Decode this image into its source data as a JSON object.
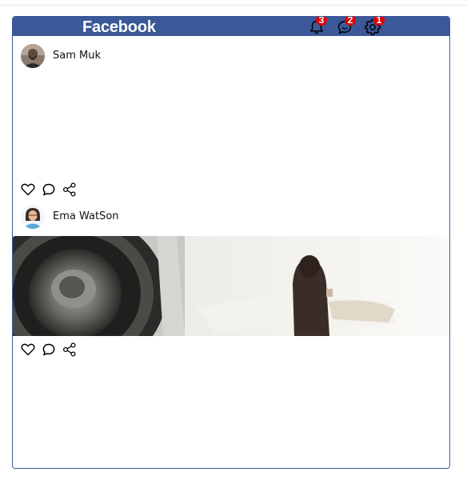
{
  "navbar": {
    "brand": "Facebook",
    "notifications": {
      "icon": "bell-icon",
      "count": "3"
    },
    "messages": {
      "icon": "chat-bubbles-icon",
      "count": "2"
    },
    "settings": {
      "icon": "gear-icon",
      "count": "1"
    }
  },
  "posts": [
    {
      "author": "Sam Muk",
      "avatar": "avatar-photo",
      "has_image": false,
      "actions": [
        "heart-icon",
        "comment-icon",
        "share-icon"
      ]
    },
    {
      "author": "Ema WatSon",
      "avatar": "avatar-photo",
      "has_image": true,
      "image": "speaker-and-figure-photo",
      "actions": [
        "heart-icon",
        "comment-icon",
        "share-icon"
      ]
    }
  ],
  "colors": {
    "brand": "#3b5998",
    "badge": "#e00000"
  }
}
